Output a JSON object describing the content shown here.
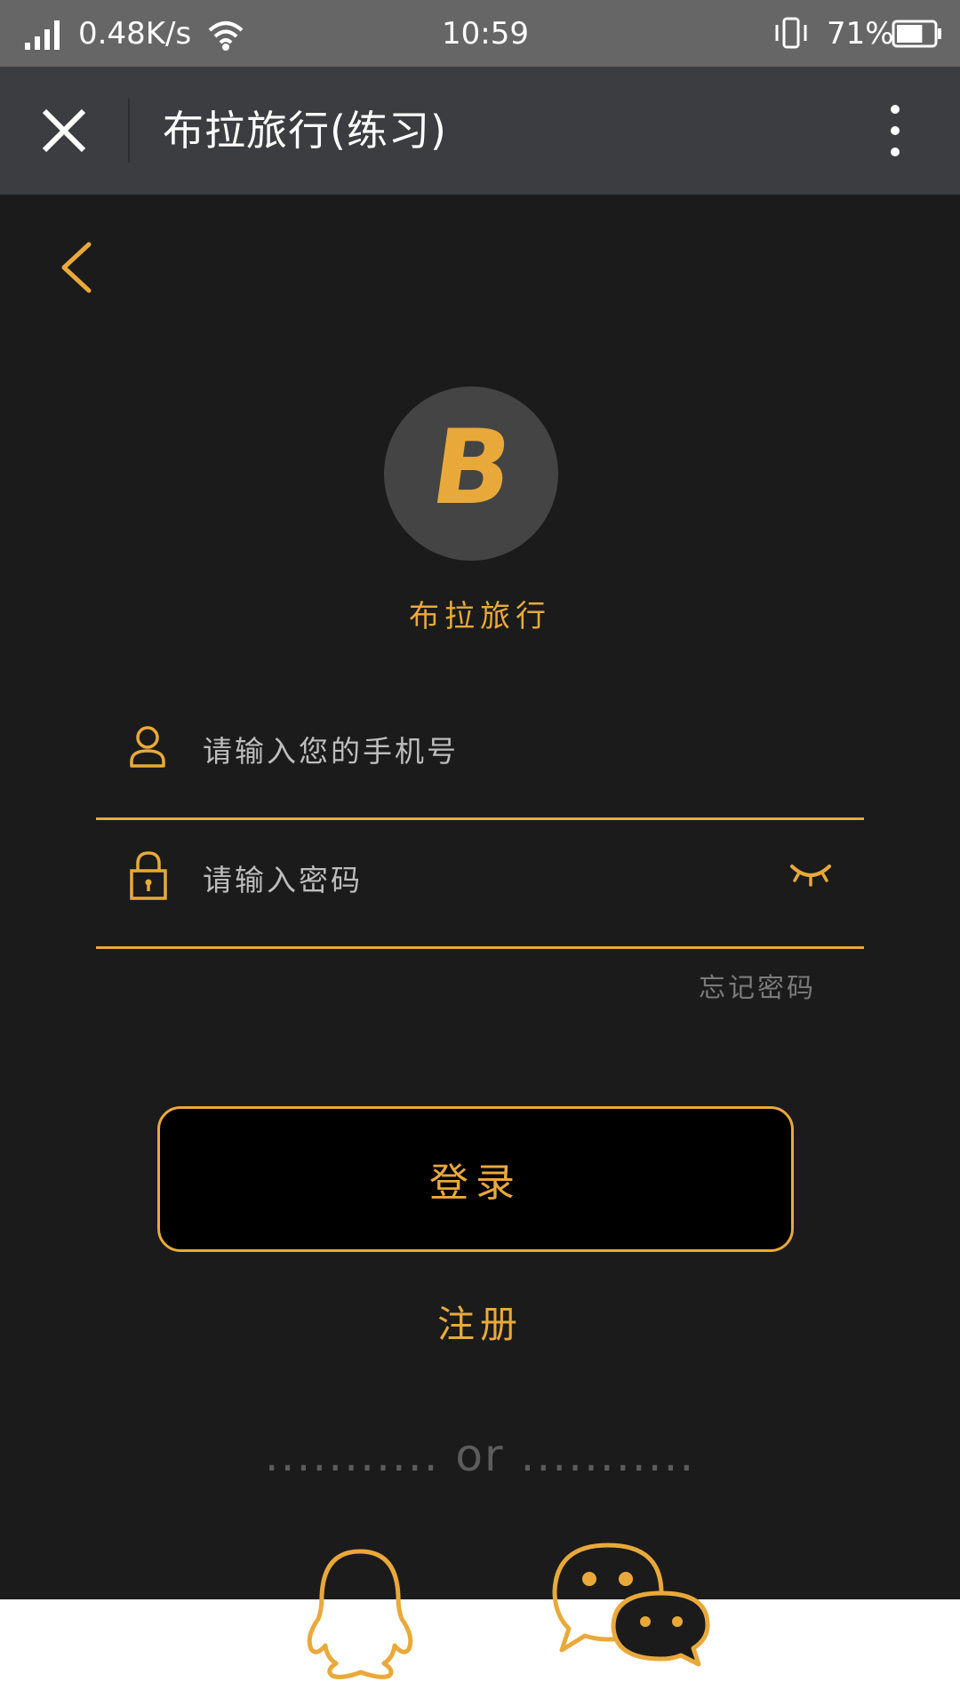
{
  "status_bar": {
    "network_speed": "0.48K/s",
    "time": "10:59",
    "battery": "71%",
    "battery_level": 0.71,
    "icons": [
      "signal-icon",
      "wifi-icon",
      "vibrate-icon",
      "battery-icon"
    ]
  },
  "title_bar": {
    "title": "布拉旅行(练习)",
    "icons": [
      "close-icon",
      "more-icon"
    ]
  },
  "login": {
    "logo_letter": "B",
    "app_name": "布拉旅行",
    "phone_placeholder": "请输入您的手机号",
    "password_placeholder": "请输入密码",
    "forgot_password": "忘记密码",
    "login_button": "登录",
    "register": "注册",
    "separator": "........... or ...........",
    "social_icons": [
      "qq-icon",
      "wechat-icon"
    ]
  },
  "colors": {
    "accent": "#e9a93a",
    "background": "#1b1b1b",
    "title_bar": "#3c3d40",
    "status_bar": "#666666"
  }
}
